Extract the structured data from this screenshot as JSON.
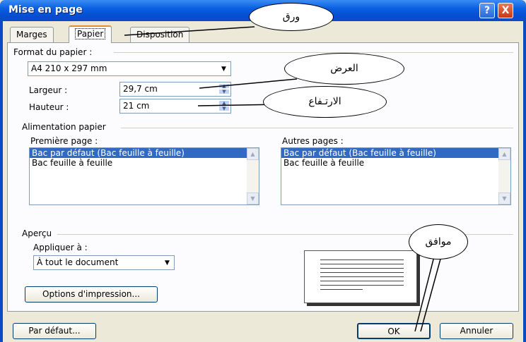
{
  "window": {
    "title": "Mise en page",
    "help_label": "?",
    "close_label": "X"
  },
  "tabs": [
    {
      "label": "Marges",
      "active": false
    },
    {
      "label": "Papier",
      "active": true
    },
    {
      "label": "Disposition",
      "active": false
    }
  ],
  "paper_format": {
    "group_label": "Format du papier :",
    "selected": "A4 210 x 297 mm",
    "width_label": "Largeur :",
    "width_value": "29,7 cm",
    "height_label": "Hauteur :",
    "height_value": "21 cm"
  },
  "paper_source": {
    "group_label": "Alimentation papier",
    "first_page_label": "Première page :",
    "first_page_items": [
      "Bac par défaut (Bac feuille à feuille)",
      "Bac feuille à feuille"
    ],
    "other_pages_label": "Autres pages :",
    "other_pages_items": [
      "Bac par défaut (Bac feuille à feuille)",
      "Bac feuille à feuille"
    ]
  },
  "preview": {
    "group_label": "Aperçu",
    "apply_label": "Appliquer à :",
    "apply_value": "À tout le document",
    "print_options_label": "Options d'impression..."
  },
  "footer": {
    "default_label": "Par défaut...",
    "ok_label": "OK",
    "cancel_label": "Annuler"
  },
  "annotations": {
    "paper_tab": "ورق",
    "width": "العرض",
    "height": "الارتـفاع",
    "ok": "موافق"
  }
}
